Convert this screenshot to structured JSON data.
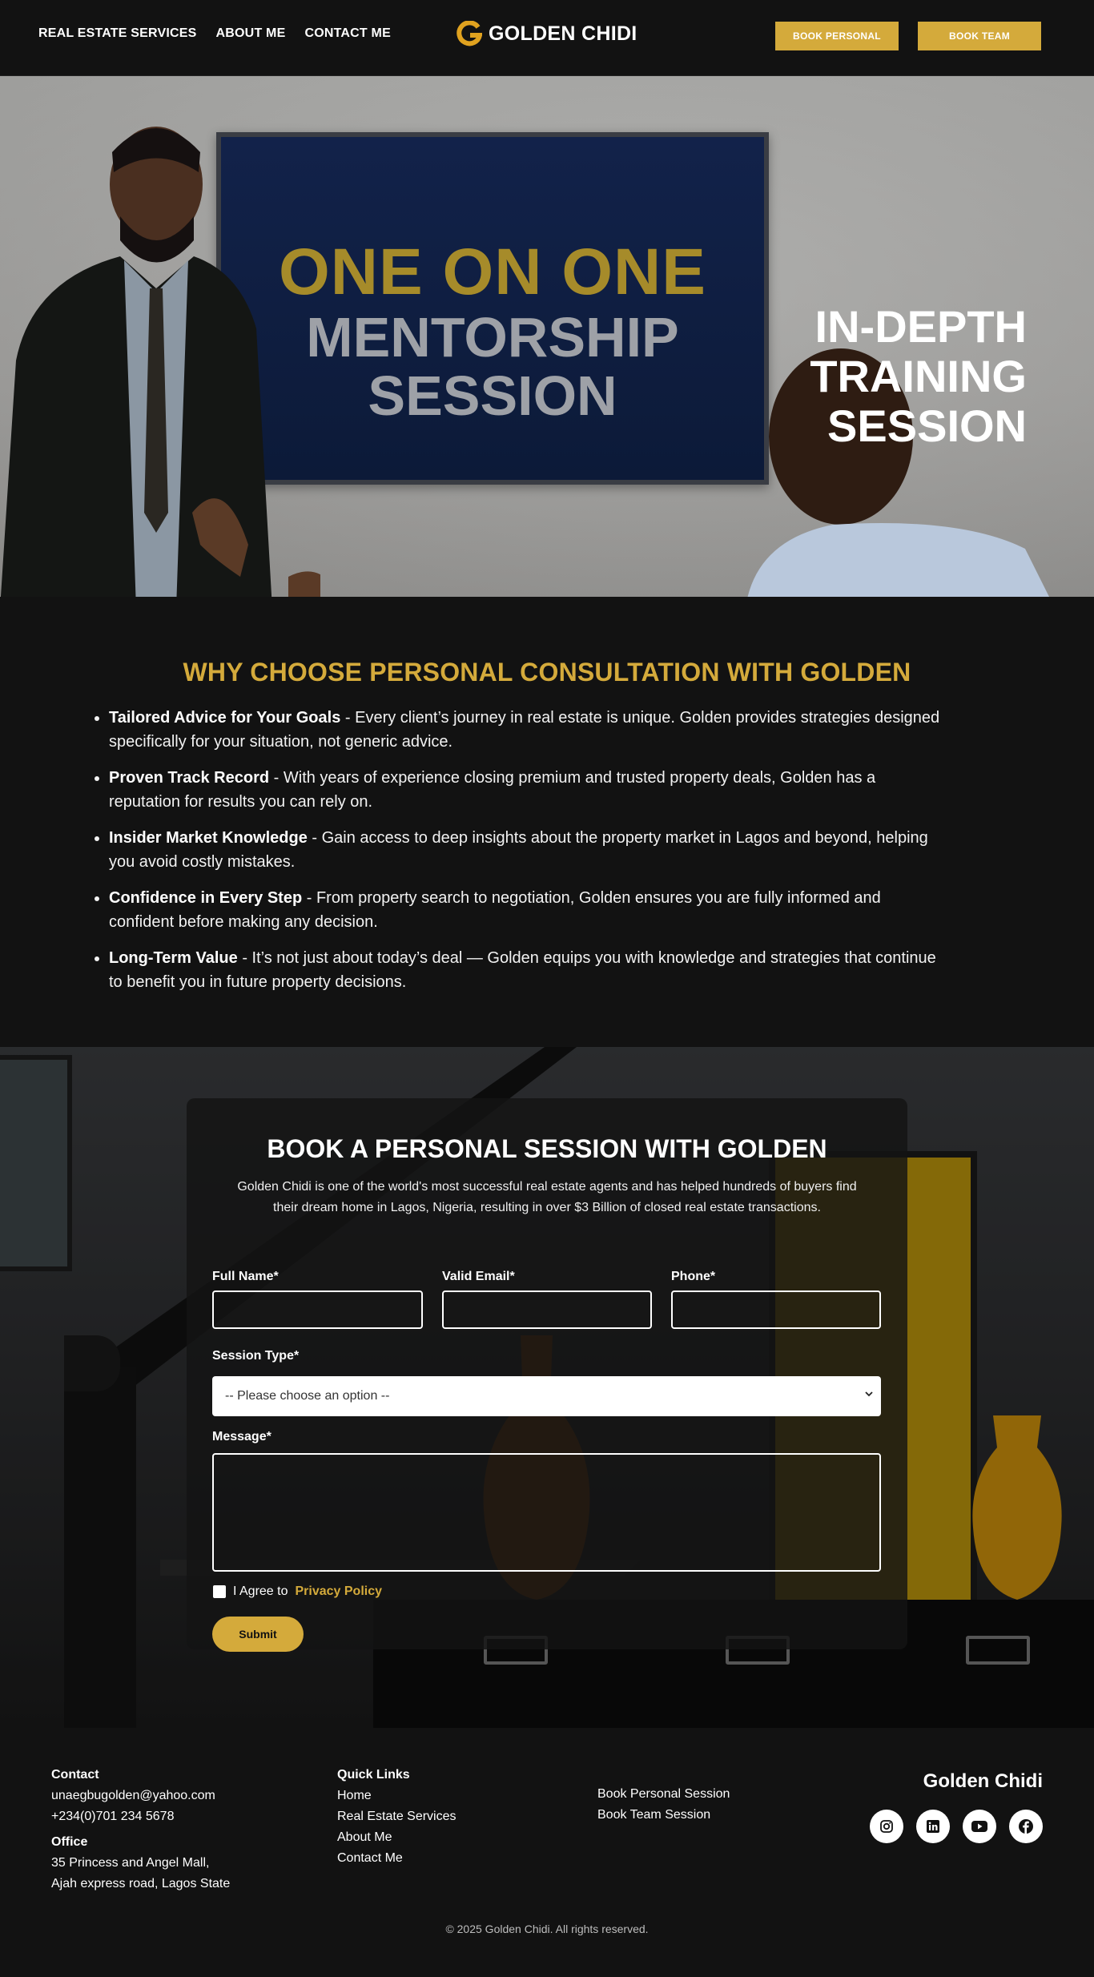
{
  "nav": {
    "links": [
      "REAL ESTATE SERVICES",
      "ABOUT ME",
      "CONTACT ME"
    ],
    "brand": "GOLDEN CHIDI",
    "book_personal": "BOOK PERSONAL",
    "book_team": "BOOK TEAM"
  },
  "hero": {
    "screen_line1": "ONE ON ONE",
    "screen_line2": "MENTORSHIP",
    "screen_line3": "SESSION",
    "title_line1": "IN-DEPTH",
    "title_line2": "TRAINING",
    "title_line3": "SESSION"
  },
  "why": {
    "title": "WHY CHOOSE PERSONAL CONSULTATION WITH GOLDEN",
    "items": [
      {
        "bold": "Tailored Advice for Your Goals",
        "text": " - Every client’s journey in real estate is unique. Golden provides strategies designed specifically for your situation, not generic advice."
      },
      {
        "bold": "Proven Track Record",
        "text": " - With years of experience closing premium and trusted property deals, Golden has a reputation for results you can rely on."
      },
      {
        "bold": "Insider Market Knowledge",
        "text": " - Gain access to deep insights about the property market in Lagos and beyond, helping you avoid costly mistakes."
      },
      {
        "bold": "Confidence in Every Step",
        "text": " - From property search to negotiation, Golden ensures you are fully informed and confident before making any decision."
      },
      {
        "bold": "Long-Term Value",
        "text": " - It’s not just about today’s deal — Golden equips you with knowledge and strategies that continue to benefit you in future property decisions."
      }
    ]
  },
  "booking": {
    "title": "BOOK A PERSONAL SESSION WITH GOLDEN",
    "description": "Golden Chidi is one of the world's most successful real estate agents and has helped hundreds of buyers find their dream home in Lagos, Nigeria, resulting in over $3 Billion of closed real estate transactions.",
    "full_name_label": "Full Name*",
    "email_label": "Valid Email*",
    "phone_label": "Phone*",
    "session_label": "Session Type*",
    "session_selected": "-- Please choose an option --",
    "message_label": "Message*",
    "agree_text": "I Agree to",
    "privacy_link": "Privacy Policy",
    "submit": "Submit"
  },
  "footer": {
    "contact_head": "Contact",
    "email": "unaegbugolden@yahoo.com",
    "phone": "+234(0)701 234 5678",
    "office_head": "Office",
    "office_line1": "35 Princess and Angel Mall,",
    "office_line2": "Ajah express road, Lagos State",
    "quick_head": "Quick Links",
    "quick_links": [
      "Home",
      "Real Estate Services",
      "About Me",
      "Contact Me"
    ],
    "book_links": [
      "Book Personal Session",
      "Book Team Session"
    ],
    "brand": "Golden Chidi",
    "socials": [
      "instagram-icon",
      "linkedin-icon",
      "youtube-icon",
      "facebook-icon"
    ],
    "copyright": "© 2025 Golden Chidi. All rights reserved."
  },
  "colors": {
    "accent": "#d4aa3b",
    "background": "#121212"
  }
}
